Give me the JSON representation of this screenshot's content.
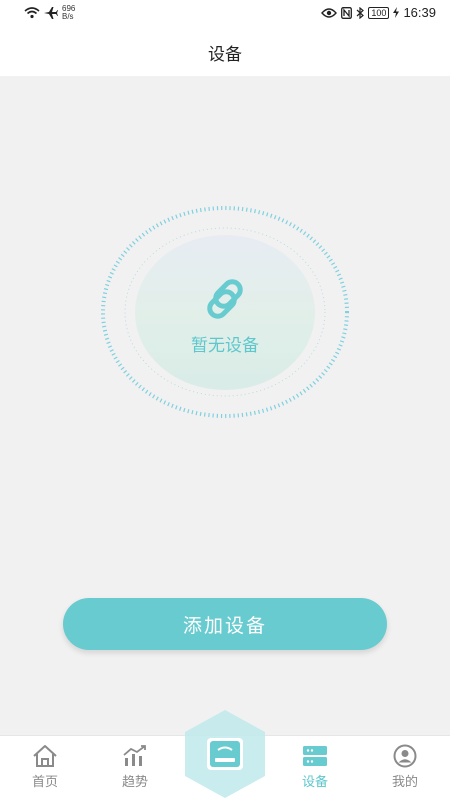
{
  "status_bar": {
    "net_speed_value": "696",
    "net_speed_unit": "B/s",
    "battery": "100",
    "time": "16:39"
  },
  "header": {
    "title": "设备"
  },
  "empty_state": {
    "message": "暂无设备"
  },
  "actions": {
    "add_device_label": "添加设备"
  },
  "tab_bar": {
    "items": [
      {
        "label": "首页",
        "icon": "home-icon",
        "active": false
      },
      {
        "label": "趋势",
        "icon": "trend-chart-icon",
        "active": false
      },
      {
        "label": "",
        "icon": "scale-icon",
        "active": false
      },
      {
        "label": "设备",
        "icon": "device-list-icon",
        "active": true
      },
      {
        "label": "我的",
        "icon": "user-icon",
        "active": false
      }
    ]
  },
  "colors": {
    "accent": "#68cbd0",
    "accent_text": "#5ec7cc",
    "background": "#f1f1f1",
    "inactive": "#8a8a8a"
  }
}
